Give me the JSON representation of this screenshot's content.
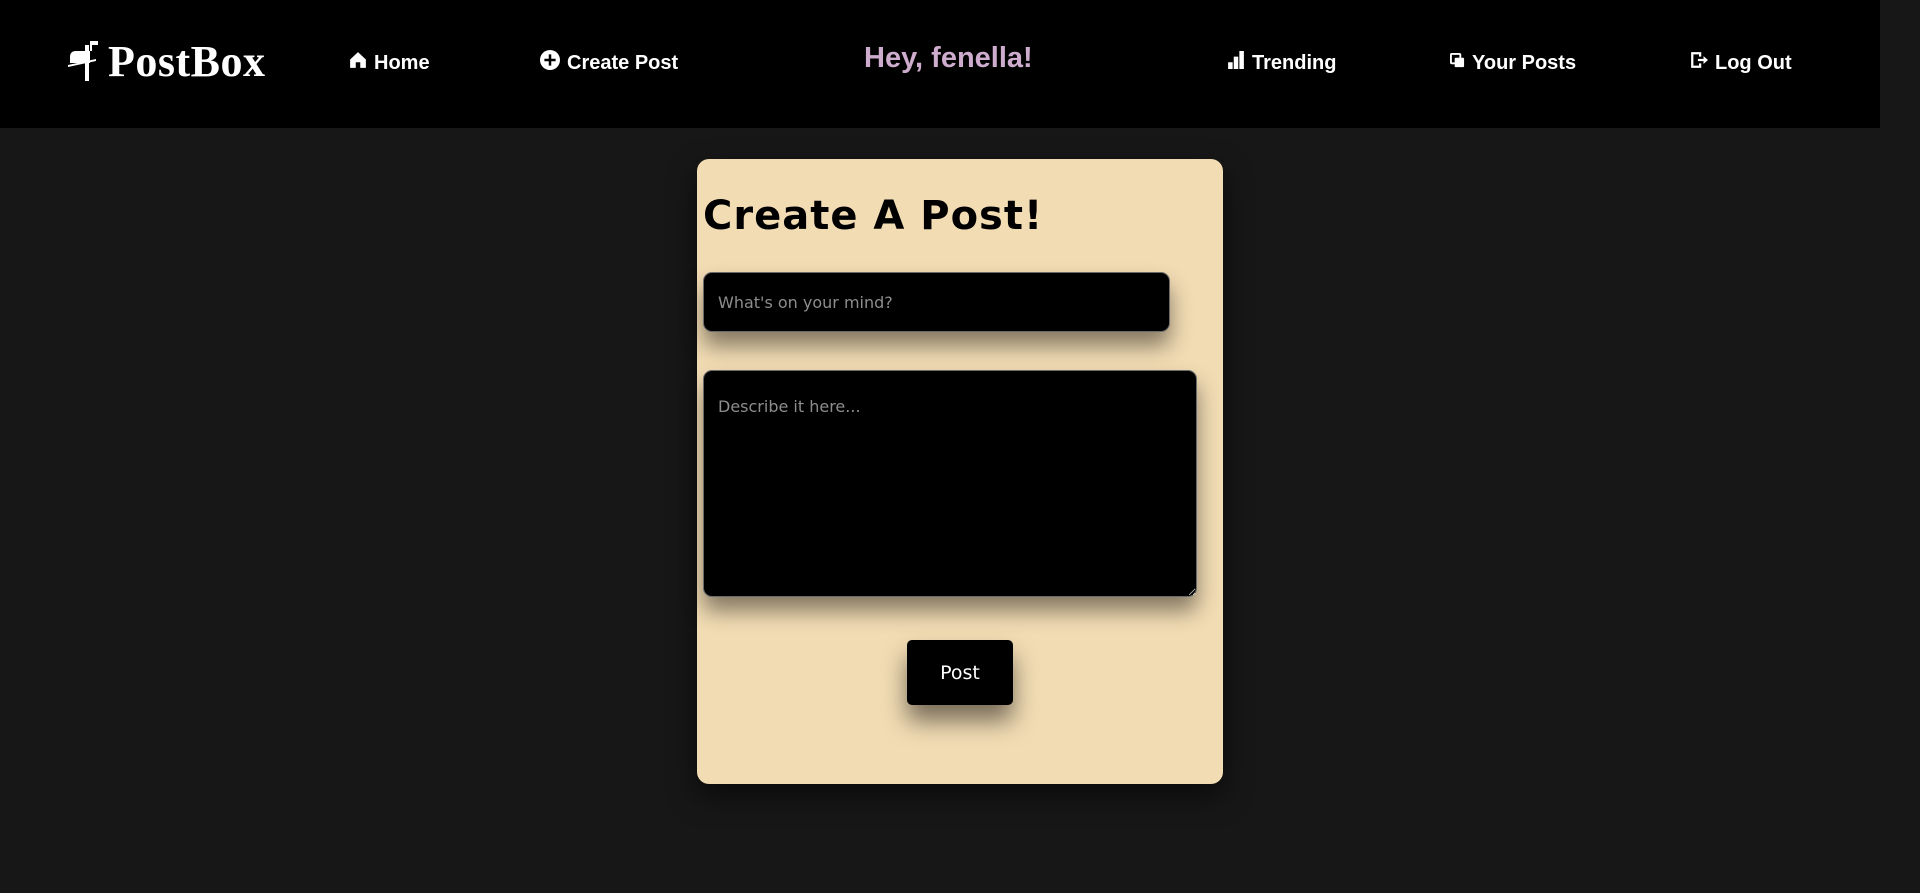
{
  "navbar": {
    "logo_text": "PostBox",
    "logo_icon": "mailbox-icon",
    "greeting": "Hey, fenella!",
    "items": [
      {
        "label": "Home",
        "icon": "home-icon"
      },
      {
        "label": "Create Post",
        "icon": "plus-circle-icon"
      },
      {
        "label": "Trending",
        "icon": "bar-chart-icon"
      },
      {
        "label": "Your Posts",
        "icon": "copy-icon"
      },
      {
        "label": "Log Out",
        "icon": "logout-icon"
      }
    ]
  },
  "form": {
    "heading": "Create A Post!",
    "title_placeholder": "What's on your mind?",
    "title_value": "",
    "description_placeholder": "Describe it here...",
    "description_value": "",
    "submit_label": "Post"
  },
  "colors": {
    "page_background": "#171717",
    "navbar_background": "#000000",
    "greeting": "#cdaccd",
    "card_background": "#f2dcb4"
  }
}
